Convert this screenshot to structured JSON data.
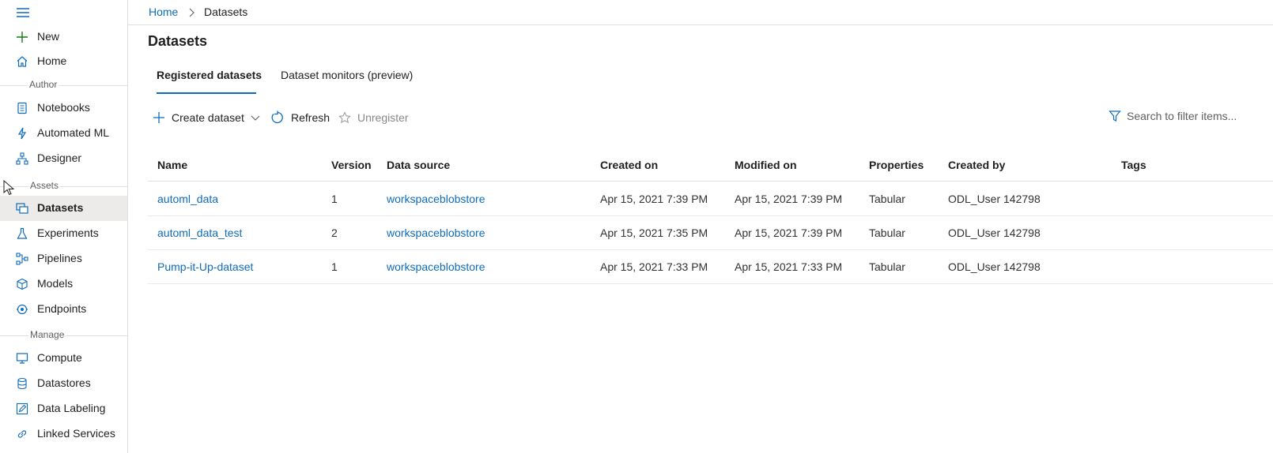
{
  "breadcrumb": {
    "home": "Home",
    "current": "Datasets"
  },
  "sidebar": {
    "top_items": [
      {
        "label": "New",
        "icon": "plus-icon"
      },
      {
        "label": "Home",
        "icon": "home-icon"
      }
    ],
    "sections": [
      {
        "title": "Author",
        "items": [
          {
            "label": "Notebooks",
            "icon": "notebook-icon"
          },
          {
            "label": "Automated ML",
            "icon": "automl-icon"
          },
          {
            "label": "Designer",
            "icon": "designer-icon"
          }
        ]
      },
      {
        "title": "Assets",
        "items": [
          {
            "label": "Datasets",
            "icon": "datasets-icon",
            "selected": true
          },
          {
            "label": "Experiments",
            "icon": "flask-icon"
          },
          {
            "label": "Pipelines",
            "icon": "pipelines-icon"
          },
          {
            "label": "Models",
            "icon": "cube-icon"
          },
          {
            "label": "Endpoints",
            "icon": "endpoint-icon"
          }
        ]
      },
      {
        "title": "Manage",
        "items": [
          {
            "label": "Compute",
            "icon": "monitor-icon"
          },
          {
            "label": "Datastores",
            "icon": "database-icon"
          },
          {
            "label": "Data Labeling",
            "icon": "edit-icon"
          },
          {
            "label": "Linked Services",
            "icon": "link-icon"
          }
        ]
      }
    ]
  },
  "page": {
    "title": "Datasets"
  },
  "tabs": [
    {
      "label": "Registered datasets",
      "active": true
    },
    {
      "label": "Dataset monitors (preview)",
      "active": false
    }
  ],
  "toolbar": {
    "create_label": "Create dataset",
    "refresh_label": "Refresh",
    "unregister_label": "Unregister",
    "filter_placeholder": "Search to filter items..."
  },
  "table": {
    "columns": [
      "Name",
      "Version",
      "Data source",
      "Created on",
      "Modified on",
      "Properties",
      "Created by",
      "Tags"
    ],
    "rows": [
      {
        "name": "automl_data",
        "version": "1",
        "source": "workspaceblobstore",
        "created": "Apr 15, 2021 7:39 PM",
        "modified": "Apr 15, 2021 7:39 PM",
        "properties": "Tabular",
        "created_by": "ODL_User 142798",
        "tags": ""
      },
      {
        "name": "automl_data_test",
        "version": "2",
        "source": "workspaceblobstore",
        "created": "Apr 15, 2021 7:35 PM",
        "modified": "Apr 15, 2021 7:39 PM",
        "properties": "Tabular",
        "created_by": "ODL_User 142798",
        "tags": ""
      },
      {
        "name": "Pump-it-Up-dataset",
        "version": "1",
        "source": "workspaceblobstore",
        "created": "Apr 15, 2021 7:33 PM",
        "modified": "Apr 15, 2021 7:33 PM",
        "properties": "Tabular",
        "created_by": "ODL_User 142798",
        "tags": ""
      }
    ]
  },
  "colors": {
    "accent": "#0f6cbd",
    "selected_bg": "#edebe9",
    "border": "#e1dfdd"
  }
}
